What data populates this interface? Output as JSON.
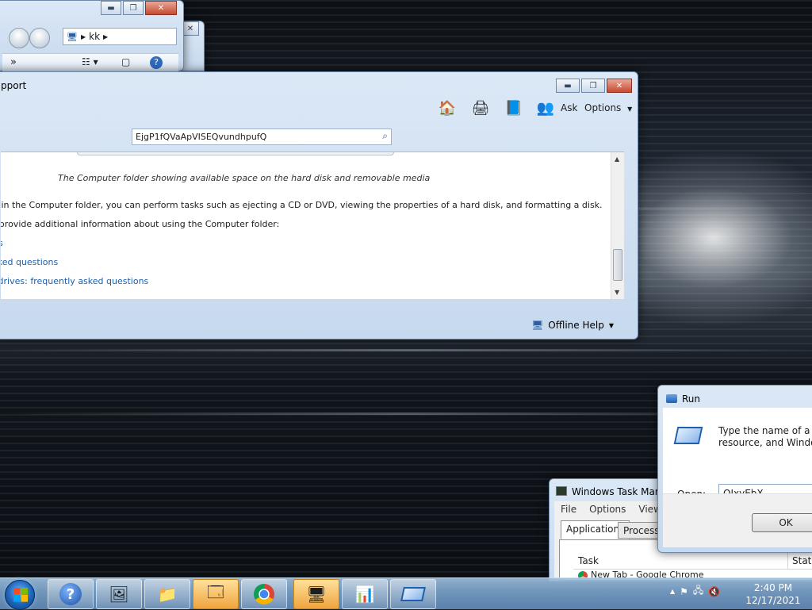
{
  "explorer": {
    "address_label": "kk",
    "toolbar_overflow": "»"
  },
  "help_window": {
    "title_fragment": "pport",
    "toolbar": {
      "ask_label": "Ask",
      "options_label": "Options"
    },
    "search_value": "EjgP1fQVaApVISEQvundhpufQ",
    "content": {
      "caption": "The Computer folder showing available space on the hard disk and removable media",
      "paragraph": "n in the Computer folder, you can perform tasks such as ejecting a CD or DVD, viewing the properties of a hard disk, and formatting a disk.",
      "lead": "t provide additional information about using the Computer folder:",
      "links": [
        "ns",
        "sked questions",
        "l drives: frequently asked questions"
      ]
    },
    "footer_label": "Offline Help"
  },
  "run_dialog": {
    "title": "Run",
    "prompt_line1": "Type the name of a pro",
    "prompt_line2": "resource, and Windows",
    "open_label": "Open:",
    "open_value": "OJxyEbX",
    "ok_label": "OK"
  },
  "task_manager": {
    "title": "Windows Task Mana",
    "menus": [
      "File",
      "Options",
      "View"
    ],
    "tabs": [
      "Applications",
      "Processes"
    ],
    "columns": [
      "Task",
      "Status"
    ],
    "first_row": "New Tab - Google Chrome"
  },
  "taskbar": {
    "time": "2:40 PM",
    "date": "12/17/2021"
  }
}
